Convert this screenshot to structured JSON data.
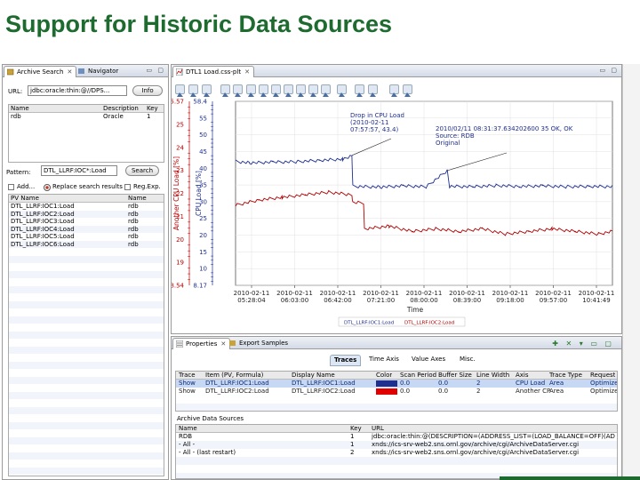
{
  "slide": {
    "title": "Support for Historic Data Sources"
  },
  "left_panel": {
    "tabs": [
      {
        "label": "Archive Search"
      },
      {
        "label": "Navigator"
      }
    ],
    "url_label": "URL:",
    "url_value": "jdbc:oracle:thin:@//DPS...",
    "info_button": "Info",
    "archives": {
      "headers": [
        "Name",
        "Description",
        "Key"
      ],
      "rows": [
        [
          "rdb",
          "Oracle",
          "1"
        ]
      ]
    },
    "pattern_label": "Pattern:",
    "pattern_value": "DTL_LLRF:IOC*:Load",
    "search_button": "Search",
    "add_label": "Add...",
    "replace_label": "Replace search results",
    "regexp_label": "Reg.Exp.",
    "results": {
      "headers": [
        "PV Name",
        "Name"
      ],
      "rows": [
        [
          "DTL_LLRF:IOC1:Load",
          "rdb"
        ],
        [
          "DTL_LLRF:IOC2:Load",
          "rdb"
        ],
        [
          "DTL_LLRF:IOC3:Load",
          "rdb"
        ],
        [
          "DTL_LLRF:IOC4:Load",
          "rdb"
        ],
        [
          "DTL_LLRF:IOC5:Load",
          "rdb"
        ],
        [
          "DTL_LLRF:IOC6:Load",
          "rdb"
        ]
      ]
    }
  },
  "plot_panel": {
    "tab_label": "DTL1 Load.css-plt",
    "annotations": [
      {
        "lines": [
          "Drop in CPU Load",
          "(2010-02-11",
          "07:57:57, 43.4)"
        ]
      },
      {
        "lines": [
          "2010/02/11 08:31:37.634202600 35 OK, OK",
          "Source: RDB",
          "Original"
        ]
      }
    ],
    "legend": [
      "DTL_LLRF:IOC1:Load",
      "DTL_LLRF:IOC2:Load"
    ]
  },
  "chart_data": {
    "type": "line",
    "title": "",
    "xlabel": "Time",
    "x_ticks": [
      "2010-02-11 05:28:04",
      "2010-02-11 06:03:00",
      "2010-02-11 06:42:00",
      "2010-02-11 07:21:00",
      "2010-02-11 08:00:00",
      "2010-02-11 08:39:00",
      "2010-02-11 09:18:00",
      "2010-02-11 09:57:00",
      "2010-02-11 10:41:49"
    ],
    "axes": [
      {
        "label": "Another CPU Load [%]",
        "color": "#c00000",
        "ylim": [
          18.54,
          25.57
        ],
        "ticks": [
          "25.57",
          "25",
          "24",
          "23",
          "22",
          "21",
          "20",
          "19",
          "18.54"
        ]
      },
      {
        "label": "CPU Load [%]",
        "color": "#1f2f8f",
        "ylim": [
          8.17,
          58.4
        ],
        "ticks": [
          "58.4",
          "55",
          "50",
          "45",
          "40",
          "35",
          "30",
          "25",
          "20",
          "15",
          "10",
          "8.17"
        ]
      }
    ],
    "series": [
      {
        "name": "DTL_LLRF:IOC1:Load",
        "color": "#1f2f8f",
        "axis": 1,
        "x": [
          0.0,
          0.3,
          0.8,
          1.3,
          1.8,
          2.3,
          2.5,
          2.52,
          3.1,
          3.6,
          4.1,
          4.55,
          4.6,
          5.1,
          5.6,
          6.1,
          6.6,
          7.1,
          7.6,
          8.1
        ],
        "y": [
          42,
          41.6,
          41.8,
          41.9,
          42.3,
          42.6,
          43.4,
          35.2,
          35,
          35.3,
          35.1,
          39.5,
          35.2,
          35.1,
          35.4,
          35.2,
          35.3,
          35.1,
          35.2,
          35.1
        ]
      },
      {
        "name": "DTL_LLRF:IOC2:Load",
        "color": "#b00000",
        "axis": 0,
        "x": [
          0.0,
          0.5,
          1.0,
          1.5,
          2.0,
          2.5,
          2.52,
          2.75,
          2.77,
          3.3,
          3.8,
          4.3,
          4.8,
          5.3,
          5.8,
          6.3,
          6.8,
          7.3,
          7.8,
          8.1
        ],
        "y": [
          21.6,
          21.8,
          21.9,
          22.0,
          22.1,
          22.0,
          21.7,
          21.7,
          20.7,
          20.8,
          20.6,
          20.7,
          20.6,
          20.7,
          20.5,
          20.6,
          20.7,
          20.6,
          20.5,
          20.6
        ]
      }
    ],
    "grid": true,
    "legend_position": "bottom"
  },
  "properties_panel": {
    "tabs": [
      {
        "label": "Properties"
      },
      {
        "label": "Export Samples"
      }
    ],
    "subtabs": [
      "Traces",
      "Time Axis",
      "Value Axes",
      "Misc."
    ],
    "trace_headers": [
      "Trace",
      "Item (PV, Formula)",
      "Display Name",
      "Color",
      "Scan Period",
      "Buffer Size",
      "Line Width",
      "Axis",
      "Trace Type",
      "Request"
    ],
    "trace_rows": [
      {
        "cells": [
          "Show",
          "DTL_LLRF:IOC1:Load",
          "DTL_LLRF:IOC1:Load",
          "",
          "0.0",
          "0.0",
          "2",
          "CPU Load",
          "Area",
          "Optimized"
        ],
        "swatch": "#1f2f8f"
      },
      {
        "cells": [
          "Show",
          "DTL_LLRF:IOC2:Load",
          "DTL_LLRF:IOC2:Load",
          "",
          "0.0",
          "0.0",
          "2",
          "Another CP",
          "Area",
          "Optimized"
        ],
        "swatch": "#e00000"
      }
    ],
    "sources_title": "Archive Data Sources",
    "source_headers": [
      "Name",
      "Key",
      "URL"
    ],
    "source_rows": [
      [
        "RDB",
        "1",
        "jdbc:oracle:thin:@(DESCRIPTION=(ADDRESS_LIST=(LOAD_BALANCE=OFF)(ADDRESS=(PR"
      ],
      [
        "- All -",
        "1",
        "xnds://ics-srv-web2.sns.ornl.gov/archive/cgi/ArchiveDataServer.cgi"
      ],
      [
        "- All - (last restart)",
        "2",
        "xnds://ics-srv-web2.sns.ornl.gov/archive/cgi/ArchiveDataServer.cgi"
      ]
    ]
  }
}
